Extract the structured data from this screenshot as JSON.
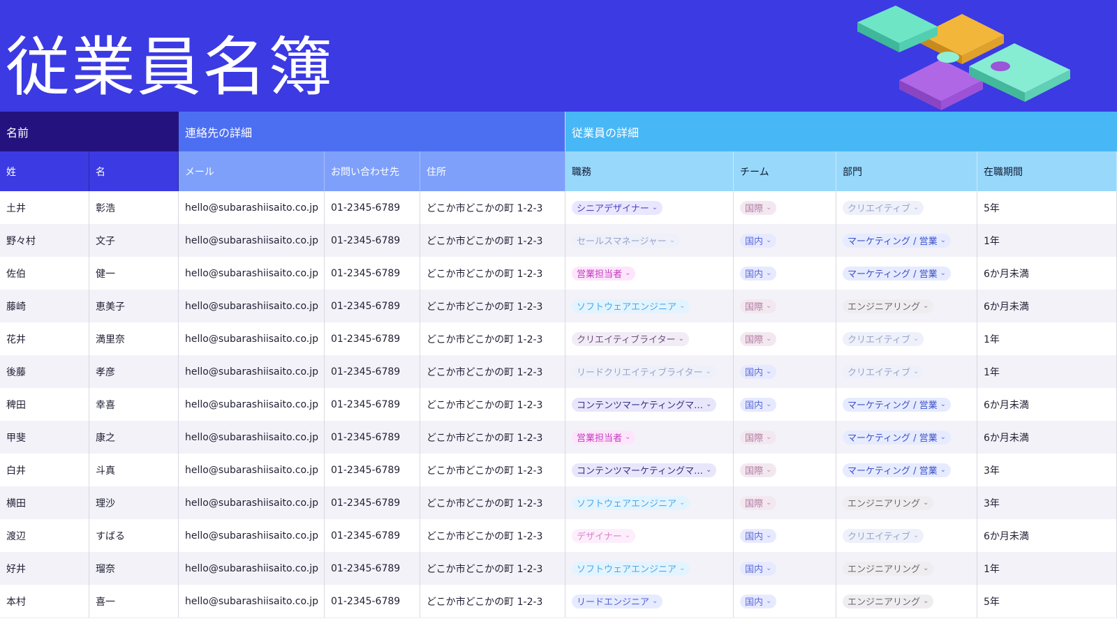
{
  "title": "従業員名簿",
  "groups": {
    "name": "名前",
    "contact": "連絡先の詳細",
    "employee": "従業員の詳細"
  },
  "columns": {
    "last": "姓",
    "first": "名",
    "mail": "メール",
    "phone": "お問い合わせ先",
    "address": "住所",
    "role": "職務",
    "team": "チーム",
    "dept": "部門",
    "tenure": "在職期間"
  },
  "chevron": "⌄",
  "colors": {
    "banner": "#3b3ae3",
    "pills": {
      "シニアデザイナー": [
        "#e9e7ff",
        "#4b3fc4"
      ],
      "セールスマネージャー": [
        "#eef0fa",
        "#98a4c8"
      ],
      "営業担当者": [
        "#fde6fb",
        "#c23ac0"
      ],
      "ソフトウェアエンジニア": [
        "#e3f4ff",
        "#4aa6e8"
      ],
      "クリエイティブライター": [
        "#f1ecf5",
        "#6d4f7d"
      ],
      "リードクリエイティブライター": [
        "#eef0fa",
        "#98a4c8"
      ],
      "コンテンツマーケティングマ…": [
        "#e8e6fb",
        "#352f7e"
      ],
      "デザイナー": [
        "#fdeefb",
        "#d982cc"
      ],
      "リードエンジニア": [
        "#e6ebff",
        "#5060d8"
      ],
      "国際": [
        "#f3e8f0",
        "#b07aa0"
      ],
      "国内": [
        "#e7eaff",
        "#5a6ad8"
      ],
      "クリエイティブ": [
        "#eef0fa",
        "#98a4c8"
      ],
      "マーケティング / 営業": [
        "#e6ebff",
        "#3b4fc8"
      ],
      "エンジニアリング": [
        "#efedf0",
        "#6c6470"
      ]
    }
  },
  "rows": [
    {
      "last": "土井",
      "first": "彰浩",
      "mail": "hello@subarashiisaito.co.jp",
      "phone": "01-2345-6789",
      "address": "どこか市どこかの町 1-2-3",
      "role": "シニアデザイナー",
      "team": "国際",
      "dept": "クリエイティブ",
      "tenure": "5年"
    },
    {
      "last": "野々村",
      "first": "文子",
      "mail": "hello@subarashiisaito.co.jp",
      "phone": "01-2345-6789",
      "address": "どこか市どこかの町 1-2-3",
      "role": "セールスマネージャー",
      "team": "国内",
      "dept": "マーケティング / 営業",
      "tenure": "1年"
    },
    {
      "last": "佐伯",
      "first": "健一",
      "mail": "hello@subarashiisaito.co.jp",
      "phone": "01-2345-6789",
      "address": "どこか市どこかの町 1-2-3",
      "role": "営業担当者",
      "team": "国内",
      "dept": "マーケティング / 営業",
      "tenure": "6か月未満"
    },
    {
      "last": "藤崎",
      "first": "恵美子",
      "mail": "hello@subarashiisaito.co.jp",
      "phone": "01-2345-6789",
      "address": "どこか市どこかの町 1-2-3",
      "role": "ソフトウェアエンジニア",
      "team": "国際",
      "dept": "エンジニアリング",
      "tenure": "6か月未満"
    },
    {
      "last": "花井",
      "first": "満里奈",
      "mail": "hello@subarashiisaito.co.jp",
      "phone": "01-2345-6789",
      "address": "どこか市どこかの町 1-2-3",
      "role": "クリエイティブライター",
      "team": "国際",
      "dept": "クリエイティブ",
      "tenure": "1年"
    },
    {
      "last": "後藤",
      "first": "孝彦",
      "mail": "hello@subarashiisaito.co.jp",
      "phone": "01-2345-6789",
      "address": "どこか市どこかの町 1-2-3",
      "role": "リードクリエイティブライター",
      "team": "国内",
      "dept": "クリエイティブ",
      "tenure": "1年"
    },
    {
      "last": "稗田",
      "first": "幸喜",
      "mail": "hello@subarashiisaito.co.jp",
      "phone": "01-2345-6789",
      "address": "どこか市どこかの町 1-2-3",
      "role": "コンテンツマーケティングマ…",
      "team": "国内",
      "dept": "マーケティング / 営業",
      "tenure": "6か月未満"
    },
    {
      "last": "甲斐",
      "first": "康之",
      "mail": "hello@subarashiisaito.co.jp",
      "phone": "01-2345-6789",
      "address": "どこか市どこかの町 1-2-3",
      "role": "営業担当者",
      "team": "国際",
      "dept": "マーケティング / 営業",
      "tenure": "6か月未満"
    },
    {
      "last": "白井",
      "first": "斗真",
      "mail": "hello@subarashiisaito.co.jp",
      "phone": "01-2345-6789",
      "address": "どこか市どこかの町 1-2-3",
      "role": "コンテンツマーケティングマ…",
      "team": "国際",
      "dept": "マーケティング / 営業",
      "tenure": "3年"
    },
    {
      "last": "横田",
      "first": "理沙",
      "mail": "hello@subarashiisaito.co.jp",
      "phone": "01-2345-6789",
      "address": "どこか市どこかの町 1-2-3",
      "role": "ソフトウェアエンジニア",
      "team": "国際",
      "dept": "エンジニアリング",
      "tenure": "3年"
    },
    {
      "last": "渡辺",
      "first": "すばる",
      "mail": "hello@subarashiisaito.co.jp",
      "phone": "01-2345-6789",
      "address": "どこか市どこかの町 1-2-3",
      "role": "デザイナー",
      "team": "国内",
      "dept": "クリエイティブ",
      "tenure": "6か月未満"
    },
    {
      "last": "好井",
      "first": "瑠奈",
      "mail": "hello@subarashiisaito.co.jp",
      "phone": "01-2345-6789",
      "address": "どこか市どこかの町 1-2-3",
      "role": "ソフトウェアエンジニア",
      "team": "国内",
      "dept": "エンジニアリング",
      "tenure": "1年"
    },
    {
      "last": "本村",
      "first": "喜一",
      "mail": "hello@subarashiisaito.co.jp",
      "phone": "01-2345-6789",
      "address": "どこか市どこかの町 1-2-3",
      "role": "リードエンジニア",
      "team": "国内",
      "dept": "エンジニアリング",
      "tenure": "5年"
    }
  ]
}
